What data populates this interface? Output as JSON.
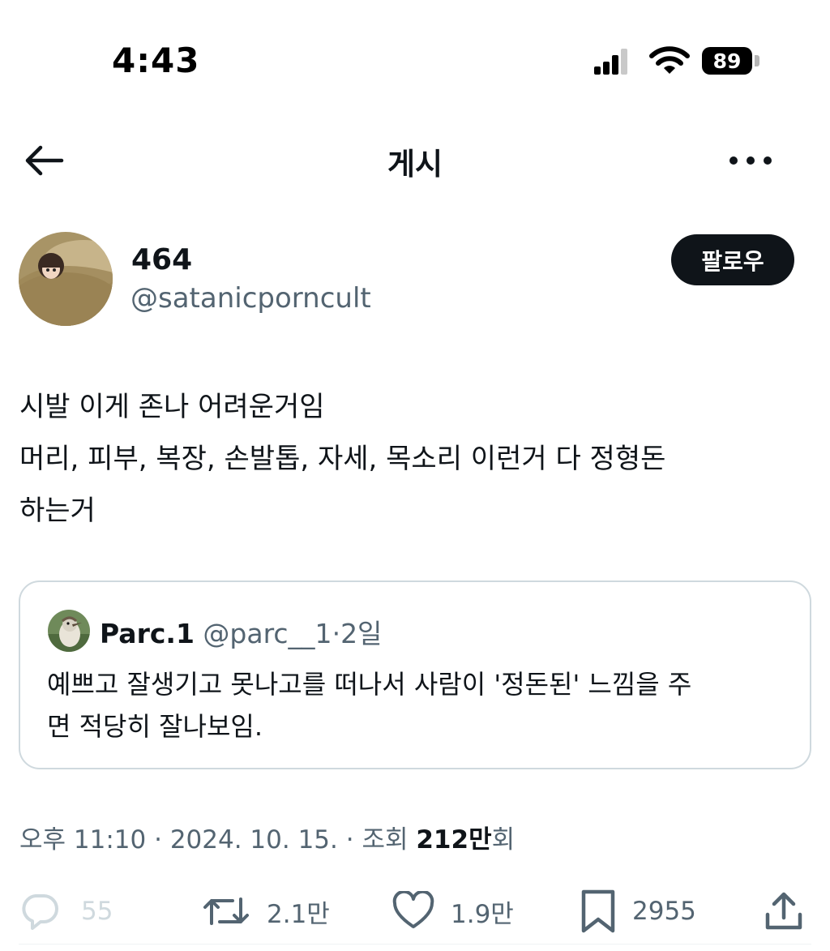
{
  "status_bar": {
    "time": "4:43",
    "battery": "89"
  },
  "nav": {
    "title": "게시"
  },
  "author": {
    "name": "464",
    "handle": "@satanicporncult",
    "follow_label": "팔로우"
  },
  "post": {
    "lines": [
      "시발 이게 존나 어려운거임",
      "머리, 피부, 복장, 손발톱, 자세, 목소리 이런거 다 정형돈",
      "하는거"
    ]
  },
  "quote": {
    "name": "Parc.1",
    "handle": "@parc__1",
    "separator": "·",
    "time": "2일",
    "lines": [
      "예쁘고 잘생기고 못나고를 떠나서 사람이 '정돈된' 느낌을 주",
      "면 적당히 잘나보임."
    ]
  },
  "meta": {
    "time": "오후 11:10",
    "date": "2024. 10. 15.",
    "views_label": "조회",
    "views_value": "212만",
    "views_suffix": "회"
  },
  "actions": {
    "replies": "55",
    "retweets": "2.1만",
    "likes": "1.9만",
    "bookmarks": "2955"
  }
}
